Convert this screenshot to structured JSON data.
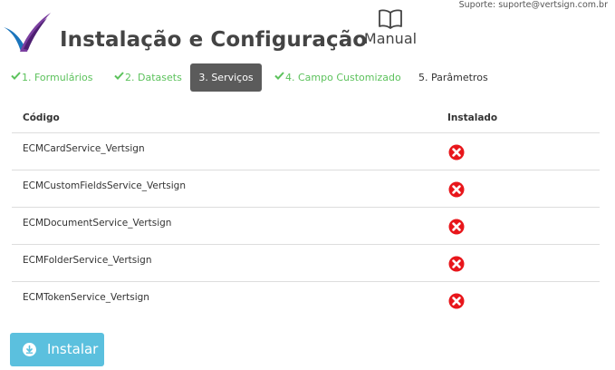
{
  "support": {
    "text": "Suporte: suporte@vertsign.com.br"
  },
  "header": {
    "title": "Instalação e Configuração",
    "manual_label": "Manual"
  },
  "steps": [
    {
      "label": "1. Formulários",
      "status": "done"
    },
    {
      "label": "2. Datasets",
      "status": "done"
    },
    {
      "label": "3. Serviços",
      "status": "active"
    },
    {
      "label": "4. Campo Customizado",
      "status": "done"
    },
    {
      "label": "5. Parâmetros",
      "status": "pending"
    }
  ],
  "table": {
    "headers": {
      "code": "Código",
      "installed": "Instalado"
    },
    "rows": [
      {
        "code": "ECMCardService_Vertsign",
        "installed": false
      },
      {
        "code": "ECMCustomFieldsService_Vertsign",
        "installed": false
      },
      {
        "code": "ECMDocumentService_Vertsign",
        "installed": false
      },
      {
        "code": "ECMFolderService_Vertsign",
        "installed": false
      },
      {
        "code": "ECMTokenService_Vertsign",
        "installed": false
      }
    ]
  },
  "install_button": {
    "label": "Instalar"
  },
  "colors": {
    "step_done": "#5cc25c",
    "step_active_bg": "#5b5b5b",
    "status_not_installed": "#e8161b",
    "install_button_bg": "#5bc0de",
    "logo_blue": "#1b75bc",
    "logo_purple": "#6a2c91"
  },
  "icons": {
    "manual": "book-icon",
    "step_done": "check-icon",
    "not_installed": "close-circle-icon",
    "install": "download-circle-icon"
  }
}
